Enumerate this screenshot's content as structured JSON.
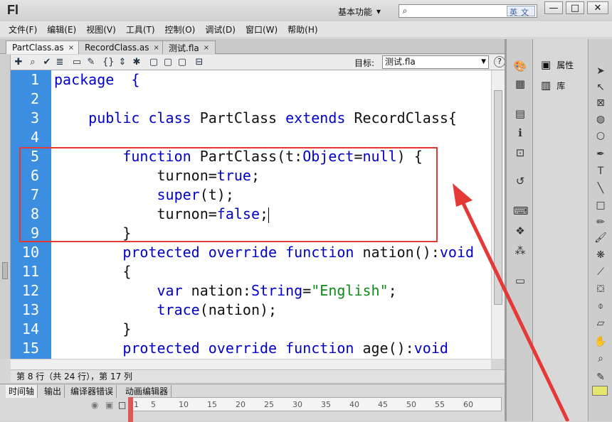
{
  "app": {
    "logo": "Fl",
    "workspace": "基本功能",
    "ime_badge": "英文"
  },
  "window_controls": {
    "minimize": "—",
    "maximize": "□",
    "close": "✕"
  },
  "menu": [
    "文件(F)",
    "编辑(E)",
    "视图(V)",
    "工具(T)",
    "控制(O)",
    "调试(D)",
    "窗口(W)",
    "帮助(H)"
  ],
  "tabs": [
    {
      "label": "PartClass.as",
      "active": true
    },
    {
      "label": "RecordClass.as",
      "active": false
    },
    {
      "label": "测试.fla",
      "active": false
    }
  ],
  "tab_close": "×",
  "toolbar": {
    "target_label": "目标:",
    "target_value": "测试.fla",
    "help": "?",
    "icons": [
      "add-statement-icon",
      "find-icon",
      "check-syntax-icon",
      "auto-format-icon",
      "code-hint-icon",
      "debug-options-icon",
      "collapse-between-braces-icon",
      "collapse-selection-icon",
      "expand-all-icon",
      "apply-block-comment-icon",
      "apply-line-comment-icon",
      "remove-comment-icon",
      "show-hide-toolbox-icon"
    ]
  },
  "editor": {
    "line_numbers": [
      "1",
      "2",
      "3",
      "4",
      "5",
      "6",
      "7",
      "8",
      "9",
      "10",
      "11",
      "12",
      "13",
      "14",
      "15"
    ],
    "lines": [
      [
        {
          "t": "package  {",
          "c": "kw1"
        }
      ],
      [],
      [
        {
          "t": "    "
        },
        {
          "t": "public class",
          "c": "kw"
        },
        {
          "t": " PartClass "
        },
        {
          "t": "extends",
          "c": "kw"
        },
        {
          "t": " RecordClass{"
        }
      ],
      [],
      [
        {
          "t": "        "
        },
        {
          "t": "function",
          "c": "kw"
        },
        {
          "t": " PartClass(t:"
        },
        {
          "t": "Object",
          "c": "kw"
        },
        {
          "t": "="
        },
        {
          "t": "null",
          "c": "kw"
        },
        {
          "t": ") {"
        }
      ],
      [
        {
          "t": "            turnon="
        },
        {
          "t": "true",
          "c": "kw"
        },
        {
          "t": ";"
        }
      ],
      [
        {
          "t": "            "
        },
        {
          "t": "super",
          "c": "kw"
        },
        {
          "t": "(t);"
        }
      ],
      [
        {
          "t": "            turnon="
        },
        {
          "t": "false",
          "c": "kw"
        },
        {
          "t": ";"
        },
        {
          "t": "",
          "c": "caret"
        }
      ],
      [
        {
          "t": "        }"
        }
      ],
      [
        {
          "t": "        "
        },
        {
          "t": "protected override function",
          "c": "kw"
        },
        {
          "t": " nation():"
        },
        {
          "t": "void",
          "c": "kw"
        }
      ],
      [
        {
          "t": "        {"
        }
      ],
      [
        {
          "t": "            "
        },
        {
          "t": "var",
          "c": "kw"
        },
        {
          "t": " nation:"
        },
        {
          "t": "String",
          "c": "kw"
        },
        {
          "t": "="
        },
        {
          "t": "\"English\"",
          "c": "st"
        },
        {
          "t": ";"
        }
      ],
      [
        {
          "t": "            "
        },
        {
          "t": "trace",
          "c": "kw"
        },
        {
          "t": "(nation);"
        }
      ],
      [
        {
          "t": "        }"
        }
      ],
      [
        {
          "t": "        "
        },
        {
          "t": "protected override function",
          "c": "kw"
        },
        {
          "t": " age():"
        },
        {
          "t": "void",
          "c": "kw"
        }
      ]
    ]
  },
  "status": "第 8 行（共 24 行），第 17 列",
  "timeline": {
    "tabs": [
      "时间轴",
      "输出",
      "编译器错误",
      "动画编辑器"
    ],
    "frame_ticks": [
      "1",
      "5",
      "10",
      "15",
      "20",
      "25",
      "30",
      "35",
      "40",
      "45",
      "50",
      "55",
      "60"
    ]
  },
  "right_panel": {
    "properties": "属性",
    "library": "库"
  },
  "colors": {
    "gutter": "#3b8ee0",
    "keyword": "#0000c8",
    "string": "#0e8a16",
    "annotation": "#e53935"
  }
}
